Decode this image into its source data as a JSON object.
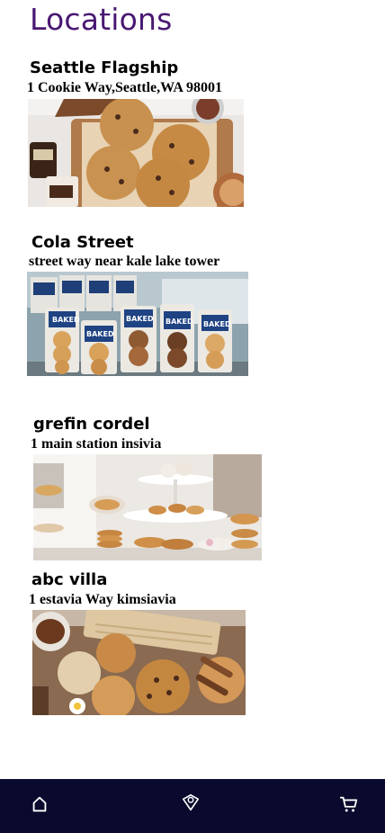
{
  "page": {
    "title": "Locations"
  },
  "locations": [
    {
      "name": "Seattle Flagship",
      "address": "1 Cookie Way,Seattle,WA 98001",
      "photo_icon": "cookies-on-board-photo"
    },
    {
      "name": "Cola Street",
      "address": "street way near kale lake tower",
      "photo_icon": "bagged-cookies-photo",
      "bag_label": "BAKED"
    },
    {
      "name": "grefin cordel",
      "address": "1 main station insivia",
      "photo_icon": "pastry-stand-photo"
    },
    {
      "name": "abc villa",
      "address": "1 estavia Way kimsiavia",
      "photo_icon": "cookie-basket-photo"
    }
  ],
  "bottom_nav": {
    "items": [
      {
        "icon": "home-icon"
      },
      {
        "icon": "location-pin-icon"
      },
      {
        "icon": "cart-icon"
      }
    ]
  },
  "colors": {
    "title": "#4a1872",
    "nav_background": "#0a0a2e",
    "nav_icon": "#ffffff"
  }
}
